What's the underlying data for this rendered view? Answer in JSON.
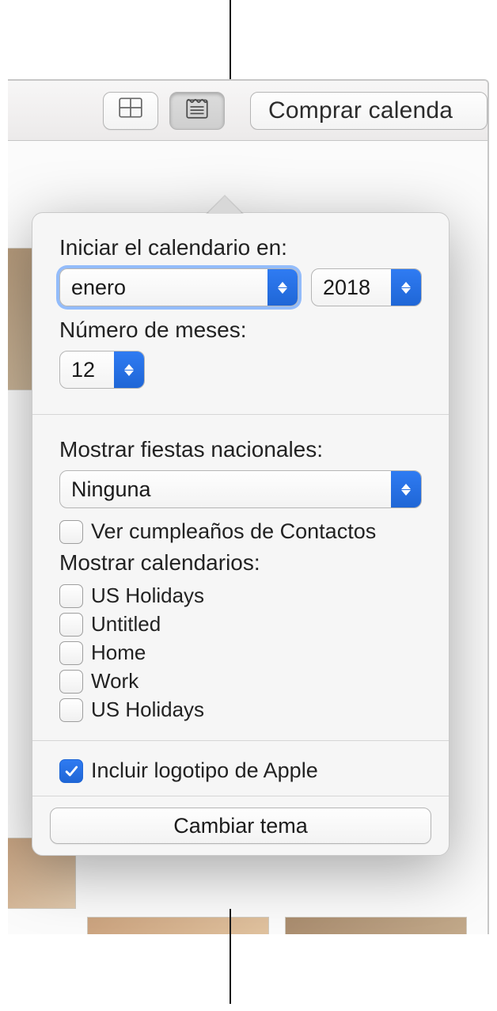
{
  "toolbar": {
    "layout_button": "layout",
    "calendar_button": "calendar-settings",
    "buy_label": "Comprar calenda"
  },
  "popover": {
    "start_label": "Iniciar el calendario en:",
    "month_value": "enero",
    "year_value": "2018",
    "months_label": "Número de meses:",
    "months_value": "12",
    "holidays_label": "Mostrar fiestas nacionales:",
    "holidays_value": "Ninguna",
    "birthdays_label": "Ver cumpleaños de Contactos",
    "calendars_label": "Mostrar calendarios:",
    "calendars": [
      {
        "label": "US Holidays"
      },
      {
        "label": "Untitled"
      },
      {
        "label": "Home"
      },
      {
        "label": "Work"
      },
      {
        "label": "US Holidays"
      }
    ],
    "apple_logo_label": "Incluir logotipo de Apple",
    "apple_logo_checked": true,
    "change_theme_label": "Cambiar tema"
  }
}
